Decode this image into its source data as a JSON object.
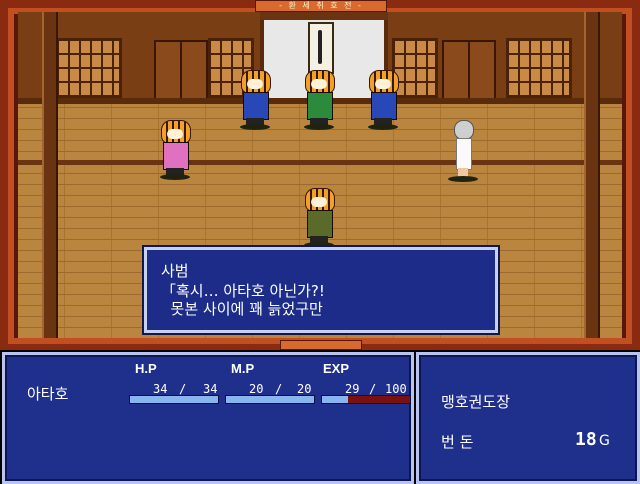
{
  "frame": {
    "banner": "- 환 세 취 호 전 -"
  },
  "scene": {
    "characters": [
      {
        "name": "tiger-blue-left",
        "outfit": "blue"
      },
      {
        "name": "tiger-green-center",
        "outfit": "green"
      },
      {
        "name": "tiger-blue-right",
        "outfit": "blue"
      },
      {
        "name": "tiger-pink",
        "outfit": "pink"
      },
      {
        "name": "girl-white-dress",
        "outfit": "white"
      },
      {
        "name": "tiger-hero",
        "outfit": "olive"
      }
    ]
  },
  "dialog": {
    "speaker": "사범",
    "line1": "「혹시… 아타호 아닌가?!",
    "line2": "  못본 사이에 꽤 늙었구만"
  },
  "party": {
    "headers": {
      "hp": "H.P",
      "mp": "M.P",
      "exp": "EXP"
    },
    "member": {
      "name": "아타호",
      "hp_current": "34",
      "hp_max": "34",
      "mp_current": "20",
      "mp_max": "20",
      "exp_current": "29",
      "exp_max": "100",
      "hp_fraction": 1.0,
      "mp_fraction": 1.0,
      "exp_fraction": 0.29
    },
    "separator": "/"
  },
  "location": {
    "name": "맹호권도장",
    "money_label": "번 돈",
    "money_amount": "18",
    "money_unit": "G"
  },
  "colors": {
    "frame_orange": "#c24f22",
    "panel_blue": "#1e2f8c",
    "bar_fill": "#88b4f0",
    "exp_empty": "#7a1010"
  }
}
